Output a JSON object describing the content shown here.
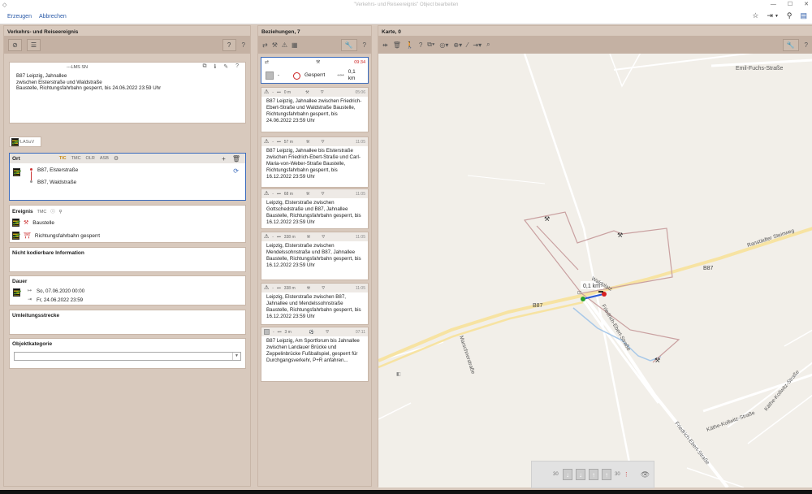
{
  "window": {
    "title": "\"Verkehrs- und Reiseereignis\" Object bearbeiten"
  },
  "menu": {
    "create": "Erzeugen",
    "cancel": "Abbrechen"
  },
  "left": {
    "title": "Verkehrs- und Reiseereignis",
    "source": "---LMS SN",
    "description_lines": [
      "B87 Leipzig, Jahnallee",
      "zwischen Elsterstraße und Waldstraße",
      "Baustelle, Richtungsfahrbahn gesperrt, bis 24.06.2022 23:59 Uhr"
    ],
    "org_label": "LASuV",
    "ort": {
      "label": "Ort",
      "tags": [
        "TIC",
        "TMC",
        "OLR",
        "ASB"
      ],
      "from": "B87, Elsterstraße",
      "to": "B87, Waldstraße"
    },
    "ereignis": {
      "label": "Ereignis",
      "tag": "TMC",
      "items": [
        "Baustelle",
        "Richtungsfahrbahn gesperrt"
      ]
    },
    "nicht": {
      "label": "Nicht kodierbare Information"
    },
    "dauer": {
      "label": "Dauer",
      "start": "So, 07.06.2020 00:00",
      "end": "Fr, 24.06.2022 23:59"
    },
    "umleitung": {
      "label": "Umleitungsstrecke"
    },
    "kategorie": {
      "label": "Objektkategorie",
      "value": ""
    }
  },
  "mid": {
    "title": "Beziehungen, 7",
    "selected": {
      "time": "09:34",
      "dash": "-",
      "status": "Gesperrt",
      "distance": "0,1 km"
    },
    "relations": [
      {
        "dist": "0 m",
        "time": "05:06",
        "text": "B87 Leipzig, Jahnallee zwischen Friedrich-Ebert-Straße und Waldstraße Baustelle, Richtungsfahrbahn gesperrt, bis 24.06.2022 23:59 Uhr"
      },
      {
        "dist": "57 m",
        "time": "11:05",
        "text": "B87 Leipzig, Jahnallee bis Elsterstraße zwischen Friedrich-Ebert-Straße und Carl-Maria-von-Weber-Straße Baustelle, Richtungsfahrbahn gesperrt, bis 16.12.2022 23:59 Uhr"
      },
      {
        "dist": "68 m",
        "time": "11:05",
        "text": "Leipzig, Elsterstraße zwischen Gottschedstraße und B87, Jahnallee Baustelle, Richtungsfahrbahn gesperrt, bis 16.12.2022 23:59 Uhr"
      },
      {
        "dist": "338 m",
        "time": "11:05",
        "text": "Leipzig, Elsterstraße zwischen Mendelssohnstraße und B87, Jahnallee Baustelle, Richtungsfahrbahn gesperrt, bis 16.12.2022 23:59 Uhr"
      },
      {
        "dist": "338 m",
        "time": "11:05",
        "text": "Leipzig, Elsterstraße zwischen B87, Jahnallee und Mendelssohnstraße Baustelle, Richtungsfahrbahn gesperrt, bis 16.12.2022 23:59 Uhr"
      },
      {
        "dist": "3 m",
        "time": "07:11",
        "text": "B87 Leipzig, Am Sportforum bis Jahnallee zwischen Landauer Brücke und Zeppelinbrücke Fußballspiel, gesperrt für Durchgangsverkehr, P+R anfahren..."
      }
    ]
  },
  "map": {
    "title": "Karte, 0",
    "labels": {
      "emil": "Emil-Fuchs-Straße",
      "ranst": "Ranstädter Steinweg",
      "b87a": "B87",
      "b87b": "B87",
      "friedrich": "Friedrich-Ebert-Straße",
      "friedrich2": "Friedrich-Ebert-Straße",
      "marsch": "Marschnerstraße",
      "kathe1": "Käthe-Kollwitz-Straße",
      "kathe2": "Käthe-Kollwitz-Straße",
      "wald": "Waldplatz",
      "dist": "0,1 km"
    },
    "controls": {
      "left": "30",
      "right": "30"
    }
  }
}
